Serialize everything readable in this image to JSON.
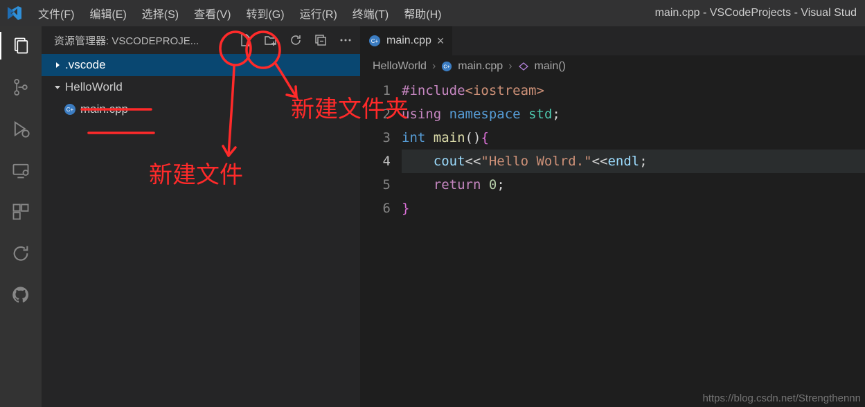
{
  "window_title": "main.cpp - VSCodeProjects - Visual Stud",
  "menu": [
    "文件(F)",
    "编辑(E)",
    "选择(S)",
    "查看(V)",
    "转到(G)",
    "运行(R)",
    "终端(T)",
    "帮助(H)"
  ],
  "sidebar_title": "资源管理器: VSCODEPROJE...",
  "tree": {
    "folder1": ".vscode",
    "folder2": "HelloWorld",
    "file1": "main.cpp"
  },
  "tab": {
    "label": "main.cpp"
  },
  "breadcrumb": {
    "seg1": "HelloWorld",
    "seg2": "main.cpp",
    "seg3": "main()"
  },
  "code": {
    "l1_pp": "#include",
    "l1_head": "<iostream>",
    "l2_u": "using",
    "l2_ns": "namespace",
    "l2_std": "std",
    "l2_sc": ";",
    "l3_int": "int",
    "l3_main": "main",
    "l3_par": "()",
    "l3_ob": "{",
    "l4_indent": "    ",
    "l4_cout": "cout",
    "l4_op1": "<<",
    "l4_str": "\"Hello Wolrd.\"",
    "l4_op2": "<<",
    "l4_endl": "endl",
    "l4_sc": ";",
    "l5_indent": "    ",
    "l5_ret": "return",
    "l5_sp": " ",
    "l5_zero": "0",
    "l5_sc": ";",
    "l6_cb": "}"
  },
  "line_numbers": [
    "1",
    "2",
    "3",
    "4",
    "5",
    "6"
  ],
  "annotations": {
    "new_file": "新建文件",
    "new_folder": "新建文件夹"
  },
  "watermark": "https://blog.csdn.net/Strengthennn"
}
